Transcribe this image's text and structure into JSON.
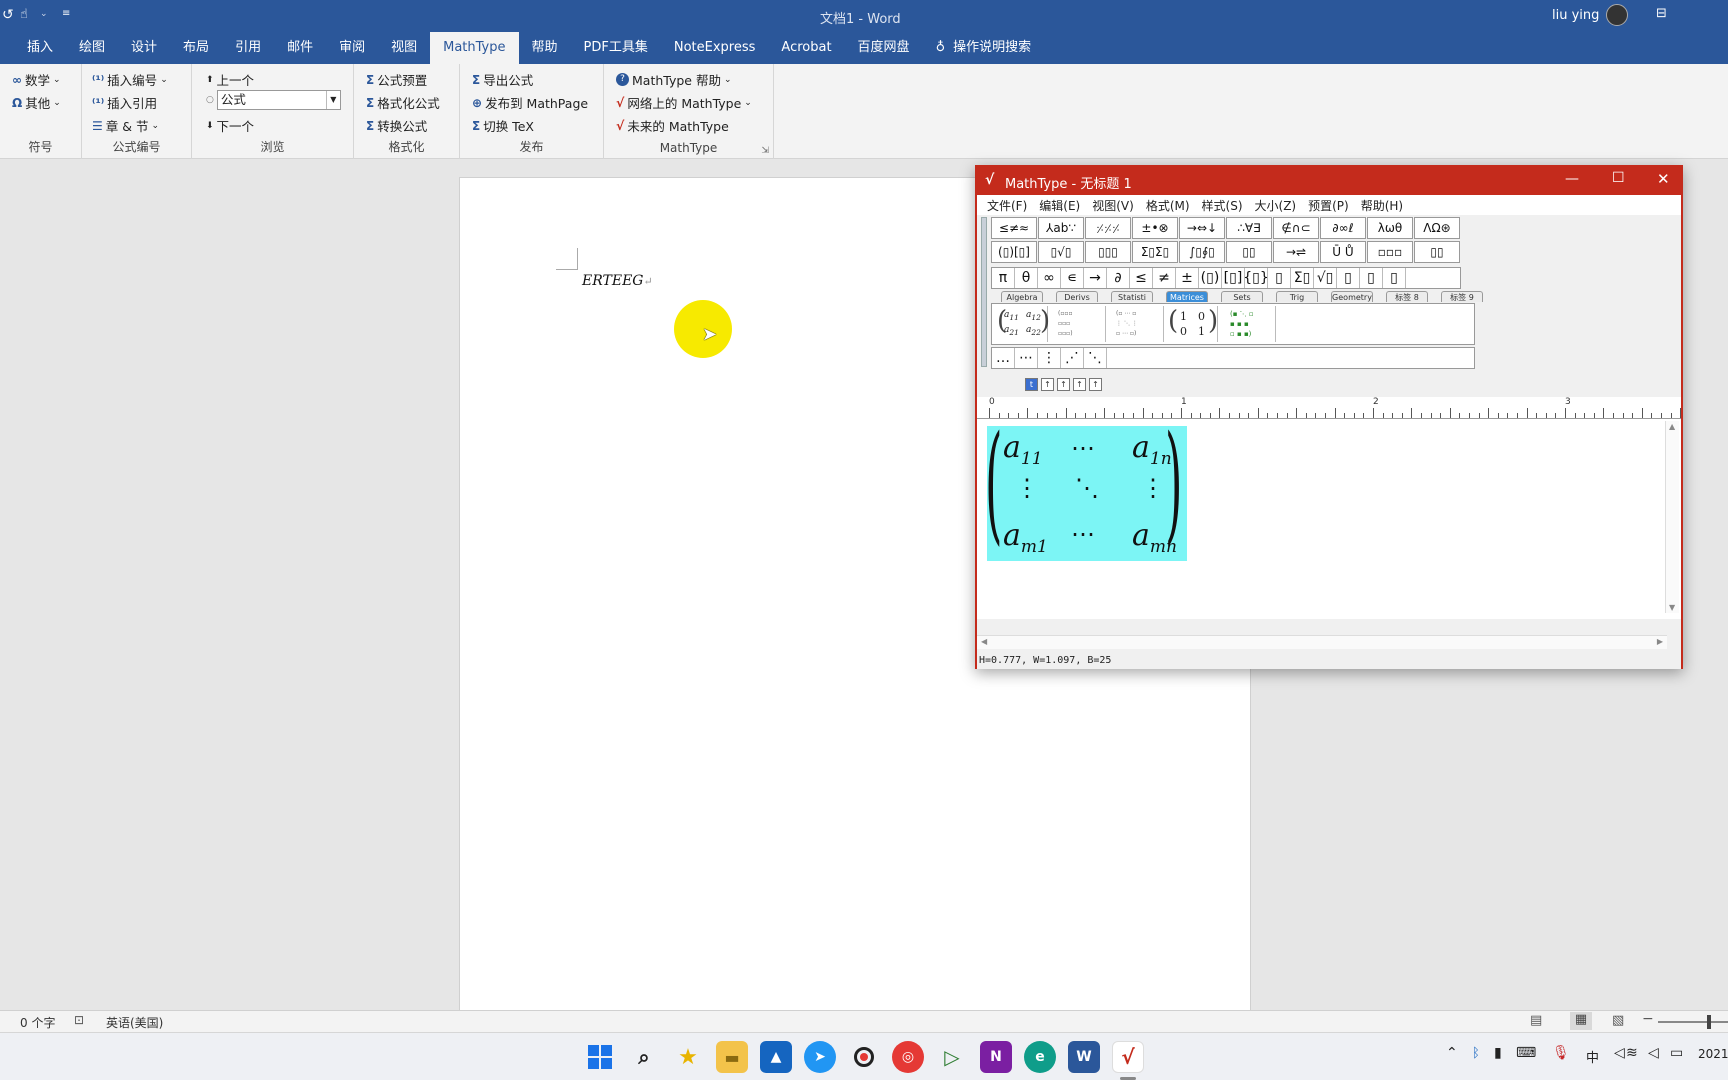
{
  "titlebar": {
    "doc_title": "文档1 - Word",
    "user": "liu ying"
  },
  "tabs": [
    "插入",
    "绘图",
    "设计",
    "布局",
    "引用",
    "邮件",
    "审阅",
    "视图",
    "MathType",
    "帮助",
    "PDF工具集",
    "NoteExpress",
    "Acrobat",
    "百度网盘"
  ],
  "active_tab": "MathType",
  "search_label": "操作说明搜索",
  "ribbon": {
    "symbols": {
      "math": "数学",
      "other": "其他",
      "label": "符号"
    },
    "numbering": {
      "insert_number": "插入编号",
      "insert_ref": "插入引用",
      "chapter": "章 & 节",
      "label": "公式编号"
    },
    "browse": {
      "prev": "上一个",
      "combo_value": "公式",
      "next": "下一个",
      "label": "浏览"
    },
    "format": {
      "preset": "公式预置",
      "format_eq": "格式化公式",
      "convert": "转换公式",
      "label": "格式化"
    },
    "publish": {
      "export": "导出公式",
      "publish_page": "发布到 MathPage",
      "toggle_tex": "切换 TeX",
      "label": "发布"
    },
    "mathtype": {
      "help": "MathType 帮助",
      "online": "网络上的 MathType",
      "future": "未来的 MathType",
      "label": "MathType"
    }
  },
  "document": {
    "text": "ERTEEG"
  },
  "statusbar": {
    "words": "0 个字",
    "language": "英语(美国)"
  },
  "clock": "2021-",
  "ime": "中",
  "mathtype": {
    "title": "MathType - 无标题 1",
    "menu": [
      "文件(F)",
      "编辑(E)",
      "视图(V)",
      "格式(M)",
      "样式(S)",
      "大小(Z)",
      "预置(P)",
      "帮助(H)"
    ],
    "row1": [
      "≤≠≈",
      "⅄ab∵",
      "⸓⸓⸓",
      "±•⊗",
      "→⇔↓",
      "∴∀∃",
      "∉∩⊂",
      "∂∞ℓ",
      "λωθ",
      "ΛΩ⊛"
    ],
    "row2": [
      "(▯)[▯]",
      "▯√▯",
      "▯▯▯",
      "Σ▯Σ▯",
      "∫▯∮▯",
      "▯▯",
      "→⇌",
      "Ū Ů",
      "▫▫▫",
      "▯▯"
    ],
    "row3": [
      "π",
      "θ",
      "∞",
      "∊",
      "→",
      "∂",
      "≤",
      "≠",
      "±",
      "(▯)",
      "[▯]",
      "{▯}",
      "▯",
      "Σ▯",
      "√▯",
      "▯",
      "▯",
      "▯"
    ],
    "tabs": [
      "Algebra",
      "Derivs",
      "Statisti",
      "Matrices",
      "Sets",
      "Trig",
      "Geometry",
      "标签 8",
      "标签 9"
    ],
    "selected_tab": "Matrices",
    "row5": [
      "…",
      "⋯",
      "⋮",
      "⋰",
      "⋱"
    ],
    "matrix_ident": [
      "1",
      "0",
      "0",
      "1"
    ],
    "ruler_marks": [
      "0",
      "1",
      "2",
      "3"
    ],
    "status": "H=0.777, W=1.097, B=25",
    "matrix": {
      "a11": "a",
      "s11": "11",
      "a1n": "a",
      "s1n": "1n",
      "am1": "a",
      "sm1": "m1",
      "amn": "a",
      "smn": "mn"
    }
  }
}
